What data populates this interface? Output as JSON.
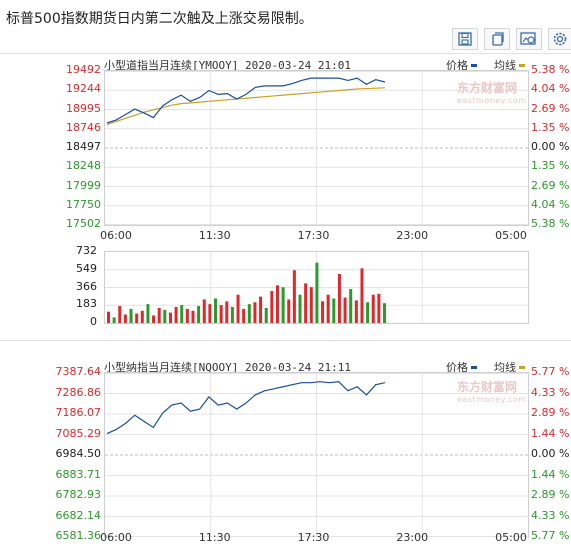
{
  "headline": "标普500指数期货日内第二次触及上涨交易限制。",
  "toolbar": [
    {
      "name": "save-button",
      "icon": "save-icon"
    },
    {
      "name": "copy-button",
      "icon": "copy-icon"
    },
    {
      "name": "image-button",
      "icon": "image-settings-icon"
    },
    {
      "name": "settings-button",
      "icon": "gear-icon"
    }
  ],
  "colors": {
    "price": "#1a4f9c",
    "avg": "#c8a028",
    "up": "#e0282b",
    "down": "#2a9a2a",
    "neutral": "#222222",
    "grid": "#e4e4e4"
  },
  "chart_data": [
    {
      "type": "line",
      "title": "小型道指当月连续[YMOOY] 2020-03-24 21:01",
      "legend": [
        "价格",
        "均线"
      ],
      "watermark": "东方财富网",
      "watermark_sub": "eastmoney.com",
      "prev_close": 18497,
      "y_ticks": [
        "19492",
        "19244",
        "18995",
        "18746",
        "18497",
        "18248",
        "17999",
        "17750",
        "17502"
      ],
      "pct_ticks": [
        "5.38 %",
        "4.04 %",
        "2.69 %",
        "1.35 %",
        "0.00 %",
        "1.35 %",
        "2.69 %",
        "4.04 %",
        "5.38 %"
      ],
      "x_ticks": [
        "06:00",
        "11:30",
        "17:30",
        "23:00",
        "05:00"
      ],
      "ylim": [
        17502,
        19492
      ],
      "price": [
        18820,
        18860,
        18930,
        19000,
        18950,
        18890,
        19040,
        19120,
        19180,
        19100,
        19150,
        19240,
        19190,
        19200,
        19130,
        19190,
        19280,
        19300,
        19300,
        19300,
        19330,
        19370,
        19400,
        19400,
        19400,
        19400,
        19370,
        19400,
        19320,
        19380,
        19350
      ],
      "avg": [
        18800,
        18840,
        18880,
        18920,
        18960,
        18990,
        19020,
        19050,
        19070,
        19080,
        19090,
        19100,
        19110,
        19120,
        19130,
        19140,
        19150,
        19160,
        19170,
        19180,
        19190,
        19200,
        19210,
        19220,
        19230,
        19240,
        19250,
        19260,
        19265,
        19270,
        19275
      ],
      "volume_ticks": [
        "732",
        "549",
        "366",
        "183",
        "0"
      ],
      "volume_max": 732,
      "volume": [
        120,
        60,
        180,
        90,
        150,
        100,
        130,
        200,
        80,
        160,
        140,
        110,
        170,
        190,
        150,
        130,
        180,
        250,
        200,
        260,
        190,
        230,
        170,
        300,
        150,
        200,
        220,
        280,
        160,
        340,
        400,
        380,
        250,
        560,
        300,
        420,
        380,
        640,
        230,
        300,
        260,
        520,
        270,
        360,
        240,
        580,
        220,
        300,
        310,
        210
      ]
    },
    {
      "type": "line",
      "title": "小型纳指当月连续[NQOOY] 2020-03-24 21:11",
      "legend": [
        "价格",
        "均线"
      ],
      "watermark": "东方财富网",
      "watermark_sub": "eastmoney.com",
      "prev_close": 6984.5,
      "y_ticks": [
        "7387.64",
        "7286.86",
        "7186.07",
        "7085.29",
        "6984.50",
        "6883.71",
        "6782.93",
        "6682.14",
        "6581.36"
      ],
      "pct_ticks": [
        "5.77 %",
        "4.33 %",
        "2.89 %",
        "1.44 %",
        "0.00 %",
        "1.44 %",
        "2.89 %",
        "4.33 %",
        "5.77 %"
      ],
      "x_ticks": [
        "06:00",
        "11:30",
        "17:30",
        "23:00",
        "05:00"
      ],
      "ylim": [
        6581.36,
        7387.64
      ],
      "price": [
        7090,
        7110,
        7140,
        7180,
        7150,
        7120,
        7190,
        7230,
        7240,
        7200,
        7210,
        7270,
        7230,
        7240,
        7210,
        7240,
        7280,
        7300,
        7310,
        7320,
        7330,
        7340,
        7340,
        7345,
        7340,
        7345,
        7300,
        7320,
        7280,
        7330,
        7340
      ]
    }
  ]
}
